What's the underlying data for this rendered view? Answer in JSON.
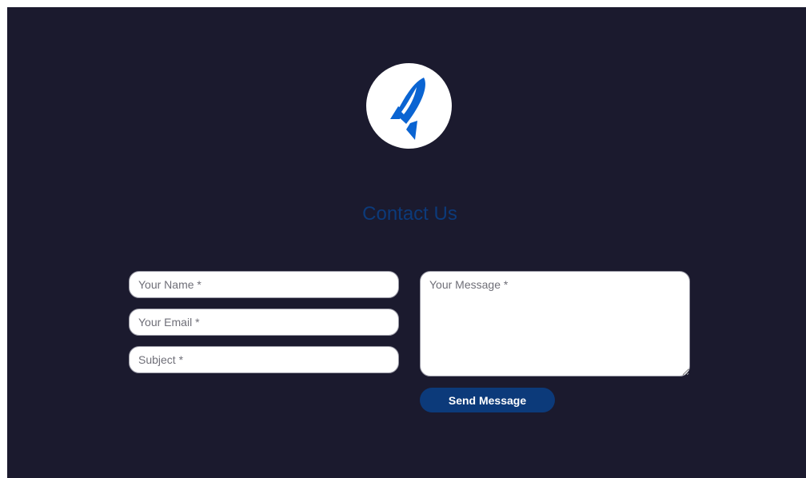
{
  "logo": {
    "icon": "rocket-icon",
    "color": "#0a64d2"
  },
  "header": {
    "title": "Contact Us"
  },
  "form": {
    "name_placeholder": "Your Name *",
    "email_placeholder": "Your Email *",
    "subject_placeholder": "Subject *",
    "message_placeholder": "Your Message *",
    "name_value": "",
    "email_value": "",
    "subject_value": "",
    "message_value": "",
    "submit_label": "Send Message"
  },
  "colors": {
    "background": "#1b1a2e",
    "accent": "#0c3a7a",
    "field_background": "#ffffff"
  }
}
